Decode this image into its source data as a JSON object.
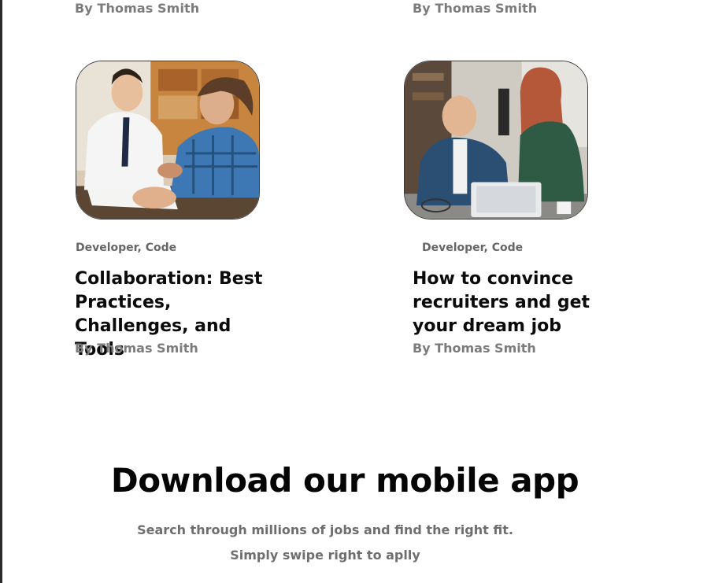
{
  "previous_row": {
    "left_author": "By Thomas Smith",
    "right_author": "By Thomas Smith"
  },
  "articles": [
    {
      "image": "team-collaboration-photo",
      "category": "Developer, Code",
      "title": "Collaboration: Best Practices, Challenges, and Tools",
      "author": "By Thomas Smith"
    },
    {
      "image": "coworkers-laptop-photo",
      "category": "Developer, Code",
      "title": "How to convince recruiters and get your dream job",
      "author": "By Thomas Smith"
    }
  ],
  "app_section": {
    "title": "Download our mobile app",
    "line1": "Search through millions of jobs and find the right fit.",
    "line2": "Simply swipe right to aplly"
  },
  "colors": {
    "heading": "#0b0b0b",
    "meta": "#7b7b7b",
    "category": "#666666",
    "left_rule": "#2b2b2b"
  }
}
